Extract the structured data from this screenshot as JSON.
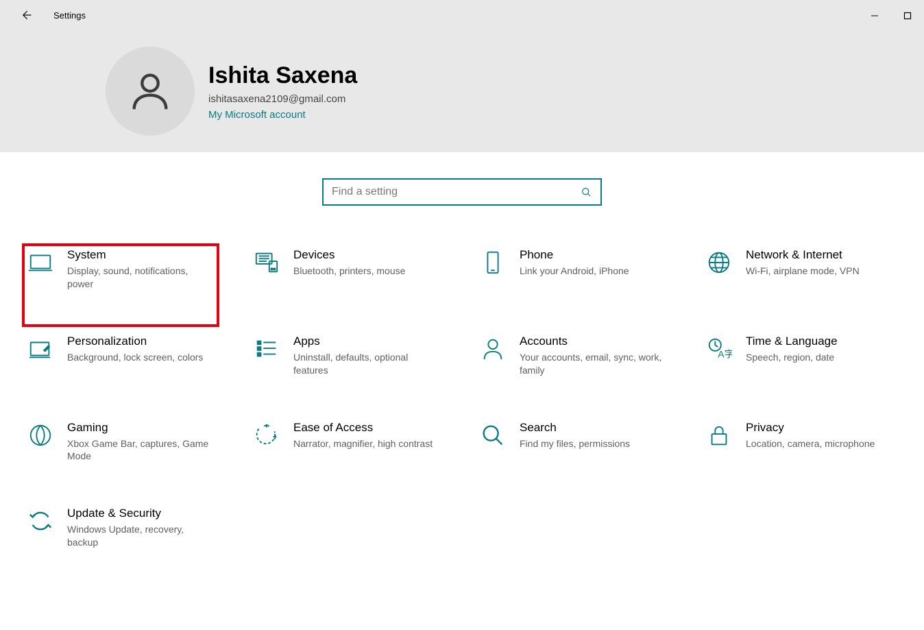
{
  "colors": {
    "accent": "#0a7b83",
    "highlight": "#e6000e"
  },
  "window": {
    "title": "Settings"
  },
  "user": {
    "name": "Ishita Saxena",
    "email": "ishitasaxena2109@gmail.com",
    "account_link": "My Microsoft account"
  },
  "search": {
    "placeholder": "Find a setting"
  },
  "tiles": [
    {
      "icon": "display-icon",
      "title": "System",
      "desc": "Display, sound, notifications, power"
    },
    {
      "icon": "devices-icon",
      "title": "Devices",
      "desc": "Bluetooth, printers, mouse"
    },
    {
      "icon": "phone-icon",
      "title": "Phone",
      "desc": "Link your Android, iPhone"
    },
    {
      "icon": "globe-icon",
      "title": "Network & Internet",
      "desc": "Wi-Fi, airplane mode, VPN"
    },
    {
      "icon": "personalization-icon",
      "title": "Personalization",
      "desc": "Background, lock screen, colors"
    },
    {
      "icon": "apps-icon",
      "title": "Apps",
      "desc": "Uninstall, defaults, optional features"
    },
    {
      "icon": "accounts-icon",
      "title": "Accounts",
      "desc": "Your accounts, email, sync, work, family"
    },
    {
      "icon": "time-language-icon",
      "title": "Time & Language",
      "desc": "Speech, region, date"
    },
    {
      "icon": "gaming-icon",
      "title": "Gaming",
      "desc": "Xbox Game Bar, captures, Game Mode"
    },
    {
      "icon": "ease-of-access-icon",
      "title": "Ease of Access",
      "desc": "Narrator, magnifier, high contrast"
    },
    {
      "icon": "search-tile-icon",
      "title": "Search",
      "desc": "Find my files, permissions"
    },
    {
      "icon": "privacy-icon",
      "title": "Privacy",
      "desc": "Location, camera, microphone"
    },
    {
      "icon": "update-icon",
      "title": "Update & Security",
      "desc": "Windows Update, recovery, backup"
    }
  ]
}
